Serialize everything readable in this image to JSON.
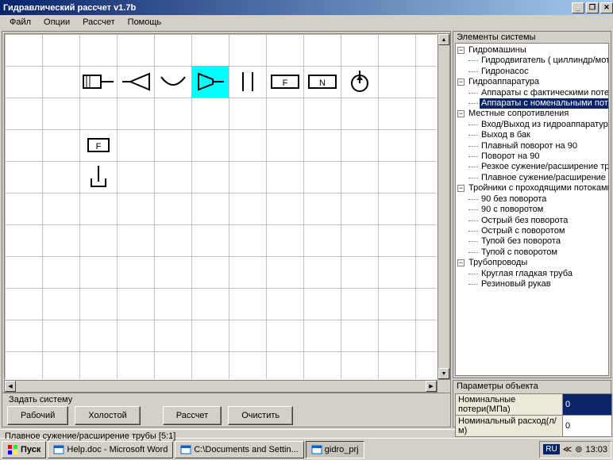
{
  "window": {
    "title": "Гидравлический рассчет v1.7b"
  },
  "menu": [
    "Файл",
    "Опции",
    "Рассчет",
    "Помощь"
  ],
  "tree": {
    "title": "Элементы системы",
    "nodes": [
      {
        "label": "Гидромашины",
        "expanded": true,
        "children": [
          {
            "label": "Гидродвигатель ( циллиндр/мотор )"
          },
          {
            "label": "Гидронасос"
          }
        ]
      },
      {
        "label": "Гидроаппаратура",
        "expanded": true,
        "children": [
          {
            "label": "Аппараты с фактическими потерями"
          },
          {
            "label": "Аппараты с номенальными потерями",
            "selected": true
          }
        ]
      },
      {
        "label": "Местные сопротивления",
        "expanded": true,
        "children": [
          {
            "label": "Вход/Выход из гидроаппаратуры"
          },
          {
            "label": "Выход в бак"
          },
          {
            "label": "Плавный поворот на 90"
          },
          {
            "label": "Поворот на 90"
          },
          {
            "label": "Резкое сужение/расширение трубы"
          },
          {
            "label": "Плавное сужение/расширение трубы"
          }
        ]
      },
      {
        "label": "Тройники с проходящими потоками",
        "expanded": true,
        "children": [
          {
            "label": "90 без поворота"
          },
          {
            "label": "90 с поворотом"
          },
          {
            "label": "Острый без поворота"
          },
          {
            "label": "Острый с поворотом"
          },
          {
            "label": "Тупой без поворота"
          },
          {
            "label": "Тупой с поворотом"
          }
        ]
      },
      {
        "label": "Трубопроводы",
        "expanded": true,
        "children": [
          {
            "label": "Круглая гладкая труба"
          },
          {
            "label": "Резиновый рукав"
          }
        ]
      }
    ]
  },
  "params": {
    "title": "Параметры объекта",
    "rows": [
      {
        "name": "Номинальные потери(МПа)",
        "value": "0",
        "selected": true
      },
      {
        "name": "Номинальный расход(л/м)",
        "value": "0"
      }
    ]
  },
  "bottom": {
    "title": "Задать систему",
    "btn_work": "Рабочий",
    "btn_idle": "Холостой",
    "btn_calc": "Рассчет",
    "btn_clear": "Очистить"
  },
  "status": "Плавное сужение/расширение трубы [5:1]",
  "taskbar": {
    "start": "Пуск",
    "items": [
      {
        "label": "Help.doc - Microsoft Word"
      },
      {
        "label": "C:\\Documents and Settin..."
      },
      {
        "label": "gidro_prj",
        "active": true
      }
    ],
    "lang": "RU",
    "clock": "13:03"
  },
  "symbol_F": "F",
  "symbol_N": "N"
}
